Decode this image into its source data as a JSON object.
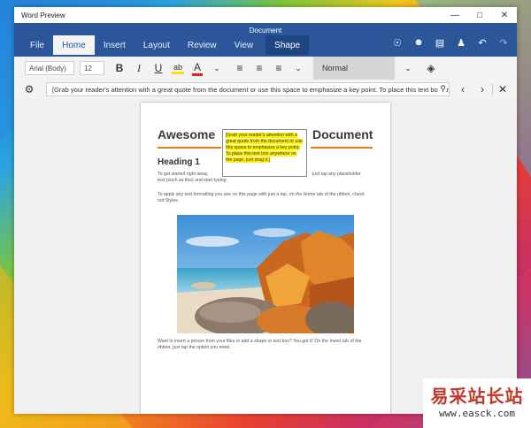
{
  "window": {
    "app_title": "Word Preview",
    "doc_title": "Document"
  },
  "tabs": [
    "File",
    "Home",
    "Insert",
    "Layout",
    "Review",
    "View",
    "Shape"
  ],
  "ribbon": {
    "font_name": "Arial (Body)",
    "font_size": "12",
    "bold": "B",
    "italic": "I",
    "underline": "U",
    "style": "Normal"
  },
  "searchbar": {
    "text": "[Grab your reader's attention with a great quote from the document or use this space to emphasize a key point. To place this text box anywhere on the page, just drag it.]"
  },
  "document": {
    "title_left": "Awesome",
    "title_right": "Document",
    "quote": "[Grab your reader's attention with a great quote from the document or use this space to emphasize a key point. To place this text box anywhere on the page, just drag it.]",
    "heading": "Heading 1",
    "para1a": "To get started right away,",
    "para1b": "just tap any placeholder",
    "para1c": "text (such as this) and start typing.",
    "para2": "To apply any text formatting you see on this page with just a tap, on the Home tab of the ribbon, check out Styles.",
    "para3": "Want to insert a picture from your files or add a shape or text box? You got it! On the Insert tab of the ribbon, just tap the option you need."
  },
  "watermark": {
    "cn": "易采站长站",
    "url": "www.easck.com"
  }
}
